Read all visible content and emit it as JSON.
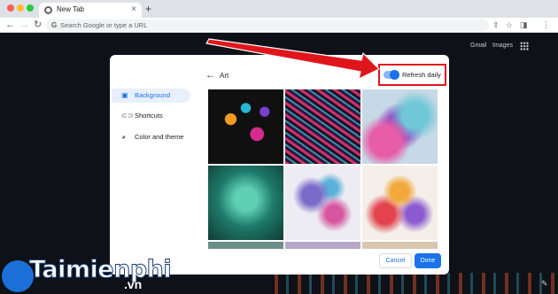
{
  "browser": {
    "tab_title": "New Tab",
    "tab_close": "×",
    "new_tab": "+",
    "address_placeholder": "Search Google or type a URL",
    "nav_back": "←",
    "nav_forward": "→",
    "nav_reload": "↻",
    "google_letter": "G",
    "toolbar_icons": [
      "share-icon",
      "star-icon",
      "side-panel-icon",
      "more-icon"
    ]
  },
  "ntp": {
    "links": [
      "Gmail",
      "Images"
    ],
    "edit_icon": "✎"
  },
  "dialog": {
    "sidebar": [
      {
        "label": "Background",
        "icon": "▣",
        "active": true
      },
      {
        "label": "Shortcuts",
        "icon": "⊂⊃",
        "active": false
      },
      {
        "label": "Color and theme",
        "icon": "◕",
        "active": false
      }
    ],
    "panel_title": "Art",
    "back_arrow": "←",
    "refresh_daily": {
      "label": "Refresh daily",
      "enabled": true
    },
    "cancel_label": "Cancel",
    "done_label": "Done"
  },
  "watermark": {
    "brand": "Taimienphi",
    "suffix": ".vn"
  },
  "colors": {
    "accent": "#1a73e8",
    "highlight_red": "#e0151c"
  }
}
